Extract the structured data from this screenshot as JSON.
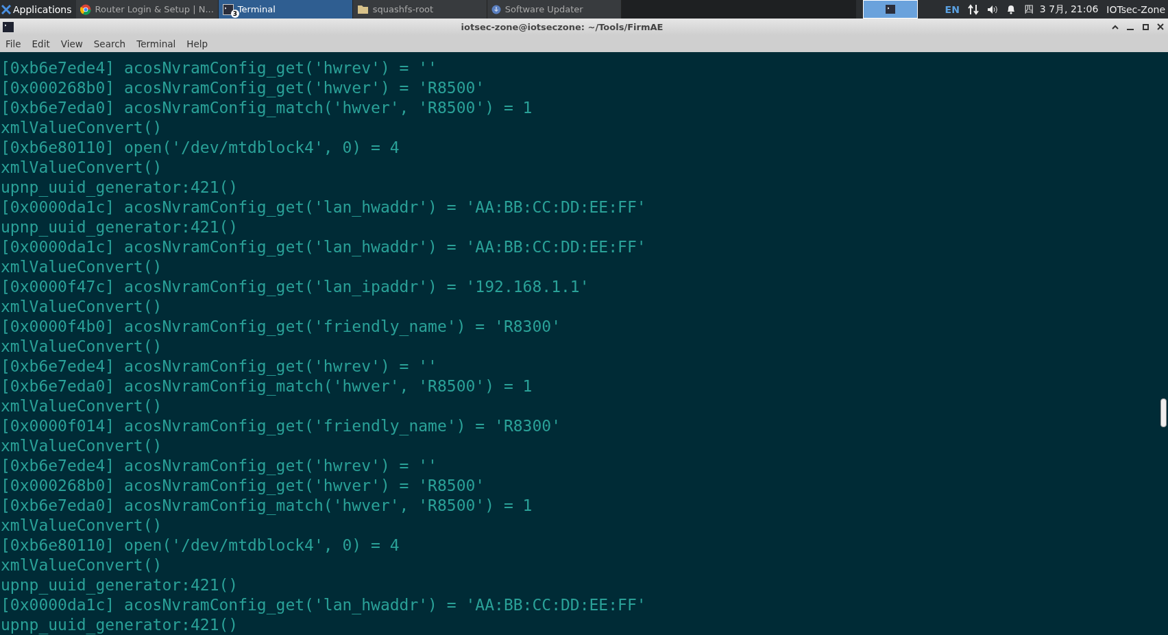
{
  "taskbar": {
    "apps_label": "Applications",
    "tasks": [
      {
        "label": "Router Login & Setup | N...",
        "selected": false
      },
      {
        "label": "Terminal",
        "selected": true,
        "badge": "3"
      },
      {
        "label": "squashfs-root",
        "selected": false
      },
      {
        "label": "Software Updater",
        "selected": false
      }
    ],
    "language": "EN",
    "clock": "四  3 7月, 21:06",
    "user": "IOTsec-Zone"
  },
  "window": {
    "title": "iotsec-zone@iotseczone: ~/Tools/FirmAE"
  },
  "menu": [
    "File",
    "Edit",
    "View",
    "Search",
    "Terminal",
    "Help"
  ],
  "terminal_lines": [
    "[0xb6e7ede4] acosNvramConfig_get('hwrev') = ''",
    "[0x000268b0] acosNvramConfig_get('hwver') = 'R8500'",
    "[0xb6e7eda0] acosNvramConfig_match('hwver', 'R8500') = 1",
    "xmlValueConvert()",
    "[0xb6e80110] open('/dev/mtdblock4', 0) = 4",
    "xmlValueConvert()",
    "upnp_uuid_generator:421()",
    "[0x0000da1c] acosNvramConfig_get('lan_hwaddr') = 'AA:BB:CC:DD:EE:FF'",
    "upnp_uuid_generator:421()",
    "[0x0000da1c] acosNvramConfig_get('lan_hwaddr') = 'AA:BB:CC:DD:EE:FF'",
    "xmlValueConvert()",
    "[0x0000f47c] acosNvramConfig_get('lan_ipaddr') = '192.168.1.1'",
    "xmlValueConvert()",
    "[0x0000f4b0] acosNvramConfig_get('friendly_name') = 'R8300'",
    "xmlValueConvert()",
    "[0xb6e7ede4] acosNvramConfig_get('hwrev') = ''",
    "[0xb6e7eda0] acosNvramConfig_match('hwver', 'R8500') = 1",
    "xmlValueConvert()",
    "[0x0000f014] acosNvramConfig_get('friendly_name') = 'R8300'",
    "xmlValueConvert()",
    "[0xb6e7ede4] acosNvramConfig_get('hwrev') = ''",
    "[0x000268b0] acosNvramConfig_get('hwver') = 'R8500'",
    "[0xb6e7eda0] acosNvramConfig_match('hwver', 'R8500') = 1",
    "xmlValueConvert()",
    "[0xb6e80110] open('/dev/mtdblock4', 0) = 4",
    "xmlValueConvert()",
    "upnp_uuid_generator:421()",
    "[0x0000da1c] acosNvramConfig_get('lan_hwaddr') = 'AA:BB:CC:DD:EE:FF'",
    "upnp_uuid_generator:421()"
  ]
}
